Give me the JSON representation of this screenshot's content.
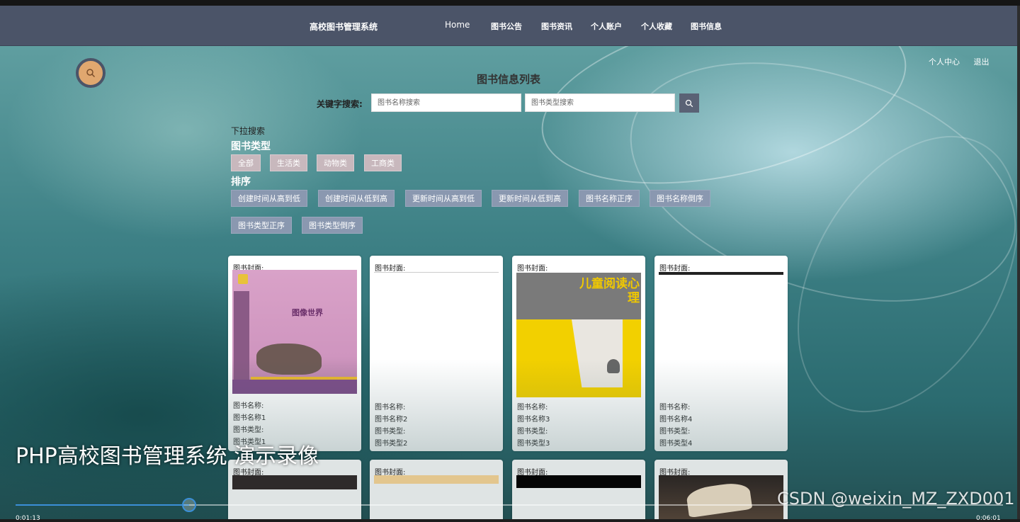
{
  "nav": {
    "title": "高校图书管理系统",
    "items": [
      "Home",
      "图书公告",
      "图书资讯",
      "个人账户",
      "个人收藏",
      "图书信息"
    ]
  },
  "user": {
    "center": "个人中心",
    "logout": "退出"
  },
  "main": {
    "title": "图书信息列表",
    "search": {
      "label": "关键字搜索:",
      "name_placeholder": "图书名称搜索",
      "type_placeholder": "图书类型搜索",
      "button_icon": "search-icon"
    },
    "filter_label": "下拉搜索",
    "type_heading": "图书类型",
    "types": [
      "全部",
      "生活类",
      "动物类",
      "工商类"
    ],
    "sort_heading": "排序",
    "sorts": [
      "创建时间从高到低",
      "创建时间从低到高",
      "更新时间从高到低",
      "更新时间从低到高",
      "图书名称正序",
      "图书名称倒序",
      "图书类型正序",
      "图书类型倒序"
    ]
  },
  "cards": [
    {
      "cover_label": "图书封面:",
      "name_label": "图书名称:",
      "name": "图书名称1",
      "type_label": "图书类型:",
      "type": "图书类型1",
      "cover_text": "图像世界"
    },
    {
      "cover_label": "图书封面:",
      "name_label": "图书名称:",
      "name": "图书名称2",
      "type_label": "图书类型:",
      "type": "图书类型2"
    },
    {
      "cover_label": "图书封面:",
      "name_label": "图书名称:",
      "name": "图书名称3",
      "type_label": "图书类型:",
      "type": "图书类型3",
      "cover_text": "儿童阅读心理"
    },
    {
      "cover_label": "图书封面:",
      "name_label": "图书名称:",
      "name": "图书名称4",
      "type_label": "图书类型:",
      "type": "图书类型4"
    }
  ],
  "cards_row2": [
    {
      "cover_label": "图书封面:"
    },
    {
      "cover_label": "图书封面:"
    },
    {
      "cover_label": "图书封面:"
    },
    {
      "cover_label": "图书封面:"
    }
  ],
  "video": {
    "caption": "PHP高校图书管理系统 演示录像",
    "watermark": "CSDN @weixin_MZ_ZXD001",
    "progress": 0.176,
    "time_current": "0:01:13",
    "time_total": "0:06:01"
  },
  "colors": {
    "navbar": "#4b5468",
    "sort_chip": "#8a98b0",
    "type_chip": "#c8b8bd",
    "progress": "#3b8fd8"
  }
}
